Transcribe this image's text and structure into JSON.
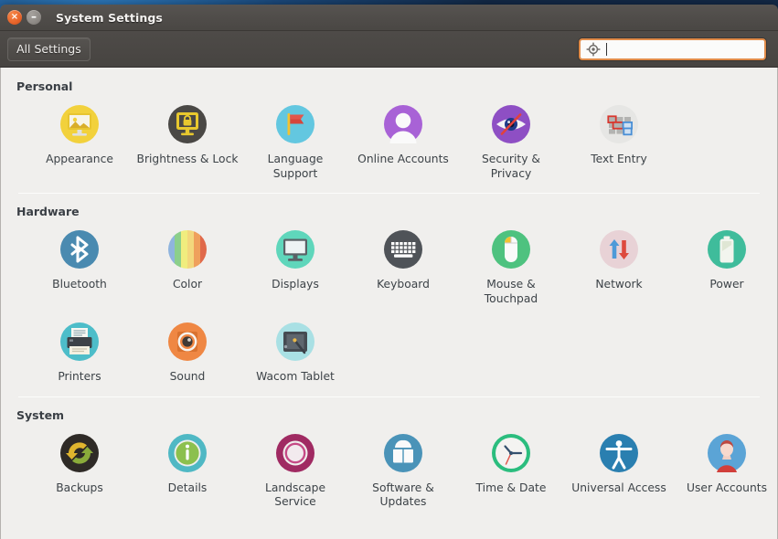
{
  "window": {
    "title": "System Settings",
    "close_label": "×",
    "minimize_label": "–"
  },
  "toolbar": {
    "all_settings_label": "All Settings",
    "search_placeholder": "",
    "search_value": "",
    "search_icon": "search-target-icon"
  },
  "sections": [
    {
      "id": "personal",
      "title": "Personal",
      "items": [
        {
          "label": "Appearance",
          "icon": "appearance-icon"
        },
        {
          "label": "Brightness & Lock",
          "icon": "brightness-lock-icon"
        },
        {
          "label": "Language Support",
          "icon": "language-support-icon"
        },
        {
          "label": "Online Accounts",
          "icon": "online-accounts-icon"
        },
        {
          "label": "Security & Privacy",
          "icon": "security-privacy-icon"
        },
        {
          "label": "Text Entry",
          "icon": "text-entry-icon"
        }
      ]
    },
    {
      "id": "hardware",
      "title": "Hardware",
      "items": [
        {
          "label": "Bluetooth",
          "icon": "bluetooth-icon"
        },
        {
          "label": "Color",
          "icon": "color-icon"
        },
        {
          "label": "Displays",
          "icon": "displays-icon"
        },
        {
          "label": "Keyboard",
          "icon": "keyboard-icon"
        },
        {
          "label": "Mouse & Touchpad",
          "icon": "mouse-touchpad-icon"
        },
        {
          "label": "Network",
          "icon": "network-icon"
        },
        {
          "label": "Power",
          "icon": "power-icon"
        },
        {
          "label": "Printers",
          "icon": "printers-icon"
        },
        {
          "label": "Sound",
          "icon": "sound-icon"
        },
        {
          "label": "Wacom Tablet",
          "icon": "wacom-tablet-icon"
        }
      ]
    },
    {
      "id": "system",
      "title": "System",
      "items": [
        {
          "label": "Backups",
          "icon": "backups-icon"
        },
        {
          "label": "Details",
          "icon": "details-icon"
        },
        {
          "label": "Landscape Service",
          "icon": "landscape-service-icon"
        },
        {
          "label": "Software & Updates",
          "icon": "software-updates-icon"
        },
        {
          "label": "Time & Date",
          "icon": "time-date-icon"
        },
        {
          "label": "Universal Access",
          "icon": "universal-access-icon"
        },
        {
          "label": "User Accounts",
          "icon": "user-accounts-icon"
        }
      ]
    }
  ],
  "colors": {
    "titlebar": "#504d4a",
    "toolbar": "#4b4845",
    "content_bg": "#f0efed",
    "accent_orange": "#e08b49",
    "close_button": "#e8642a",
    "label_text": "#3d4348",
    "section_title": "#3a3f45"
  }
}
